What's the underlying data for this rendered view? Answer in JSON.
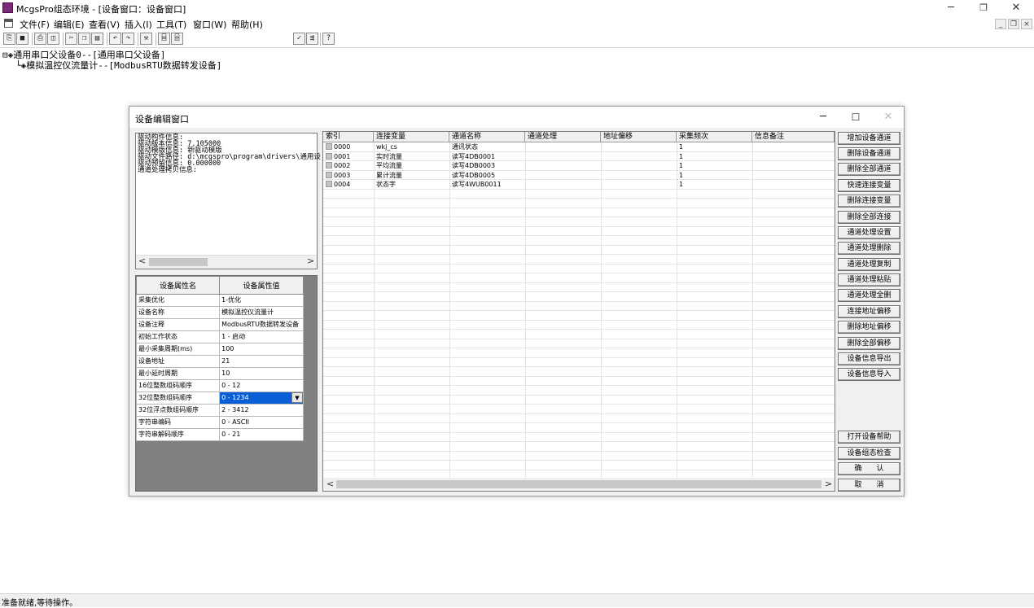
{
  "app": {
    "title": "McgsPro组态环境 - [设备窗口：设备窗口]"
  },
  "menu": [
    {
      "label": "文件(F)"
    },
    {
      "label": "编辑(E)"
    },
    {
      "label": "查看(V)"
    },
    {
      "label": "插入(I)"
    },
    {
      "label": "工具(T)"
    },
    {
      "label": "窗口(W)"
    },
    {
      "label": "帮助(H)"
    }
  ],
  "toolbar": {
    "buttons": [
      {
        "name": "new-window-icon",
        "glyph": "⎘"
      },
      {
        "name": "save-icon",
        "glyph": "■"
      },
      {
        "name": "print-icon",
        "glyph": "⎙"
      },
      {
        "name": "print-preview-icon",
        "glyph": "◫"
      },
      {
        "name": "cut-icon",
        "glyph": "✂"
      },
      {
        "name": "copy-icon",
        "glyph": "❐"
      },
      {
        "name": "paste-icon",
        "glyph": "▤"
      },
      {
        "name": "undo-icon",
        "glyph": "↶"
      },
      {
        "name": "redo-icon",
        "glyph": "↷"
      },
      {
        "name": "tool-icon",
        "glyph": "⚒"
      },
      {
        "name": "align-icon",
        "glyph": "⌸"
      },
      {
        "name": "align2-icon",
        "glyph": "⌹"
      },
      {
        "name": "check-icon",
        "glyph": "✓"
      },
      {
        "name": "compile-icon",
        "glyph": "⇶"
      },
      {
        "name": "help-icon",
        "glyph": "?"
      }
    ]
  },
  "tree": {
    "root": "⊟◈通用串口父设备0--[通用串口父设备]",
    "child": "└◈模拟温控仪流量计--[ModbusRTU数据转发设备]"
  },
  "dialog": {
    "title": "设备编辑窗口",
    "info_lines": [
      "驱动构件信息:",
      "驱动版本信息: 7.105000",
      "驱动模版信息: 新驱动模版",
      "驱动文件路径: d:\\mcgspro\\program\\drivers\\通用设",
      "驱动预留信息: 0.000000",
      "通道处理拷贝信息:"
    ],
    "props_header": {
      "name": "设备属性名",
      "value": "设备属性值"
    },
    "props": [
      {
        "name": "采集优化",
        "value": "1-优化"
      },
      {
        "name": "设备名称",
        "value": "模拟温控仪流量计"
      },
      {
        "name": "设备注释",
        "value": "ModbusRTU数据转发设备"
      },
      {
        "name": "初始工作状态",
        "value": "1 - 启动"
      },
      {
        "name": "最小采集周期(ms)",
        "value": "100"
      },
      {
        "name": "设备地址",
        "value": "21"
      },
      {
        "name": "最小延时周期",
        "value": "10"
      },
      {
        "name": "16位整数组码顺序",
        "value": "0 - 12"
      },
      {
        "name": "32位整数组码顺序",
        "value": "0 - 1234"
      },
      {
        "name": "32位浮点数组码顺序",
        "value": "2 - 3412"
      },
      {
        "name": "字符串编码",
        "value": "0 - ASCII"
      },
      {
        "name": "字符串解码顺序",
        "value": "0 - 21"
      }
    ],
    "channel_headers": [
      "索引",
      "连接变量",
      "通道名称",
      "通道处理",
      "地址偏移",
      "采集频次",
      "信息备注"
    ],
    "channels": [
      {
        "index": "0000",
        "var": "wkj_cs",
        "name": "通讯状态",
        "proc": "",
        "offset": "",
        "freq": "1",
        "note": ""
      },
      {
        "index": "0001",
        "var": "实时流量",
        "name": "读写4DB0001",
        "proc": "",
        "offset": "",
        "freq": "1",
        "note": ""
      },
      {
        "index": "0002",
        "var": "平均流量",
        "name": "读写4DB0003",
        "proc": "",
        "offset": "",
        "freq": "1",
        "note": ""
      },
      {
        "index": "0003",
        "var": "累计流量",
        "name": "读写4DB0005",
        "proc": "",
        "offset": "",
        "freq": "1",
        "note": ""
      },
      {
        "index": "0004",
        "var": "状态字",
        "name": "读写4WUB0011",
        "proc": "",
        "offset": "",
        "freq": "1",
        "note": ""
      }
    ],
    "buttons_top": [
      "增加设备通道",
      "删除设备通道",
      "删除全部通道",
      "快速连接变量",
      "删除连接变量",
      "删除全部连接",
      "通道处理设置",
      "通道处理删除",
      "通道处理复制",
      "通道处理粘贴",
      "通道处理全删",
      "连接地址偏移",
      "删除地址偏移",
      "删除全部偏移",
      "设备信息导出",
      "设备信息导入"
    ],
    "buttons_bottom": [
      "打开设备帮助",
      "设备组态检查",
      "确　　认",
      "取　　消"
    ]
  },
  "status": {
    "text": "准备就绪,等待操作。"
  },
  "colors": {
    "selection": "#0a5fd7",
    "app_icon": "#7b2a7a"
  }
}
